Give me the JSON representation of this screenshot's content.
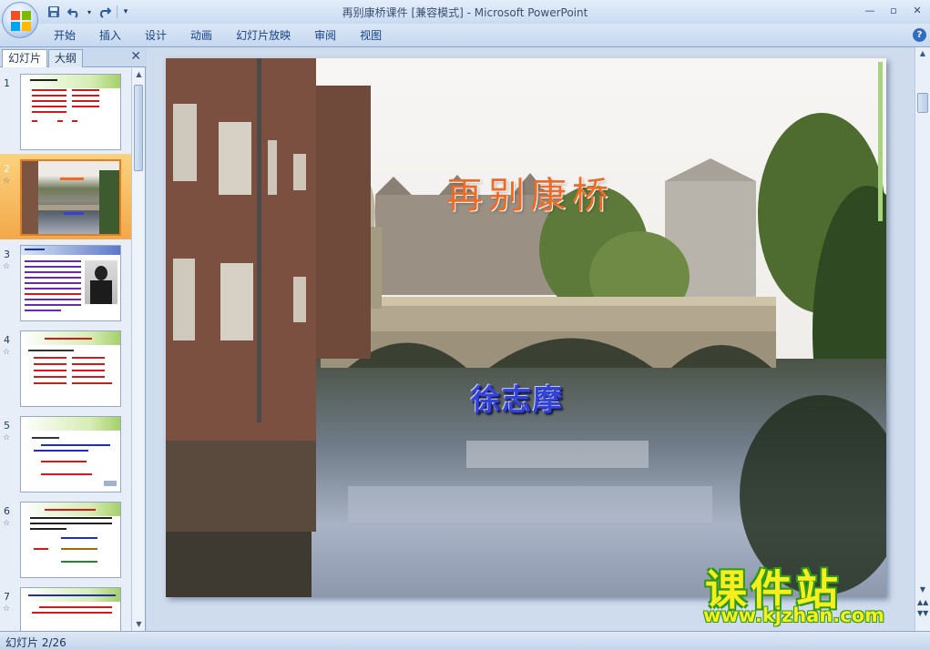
{
  "window": {
    "title": "再别康桥课件 [兼容模式] - Microsoft PowerPoint",
    "controls": {
      "minimize": "—",
      "maximize": "▫",
      "close": "✕"
    }
  },
  "qat": {
    "save_icon": "save-icon",
    "undo_icon": "undo-icon",
    "redo_icon": "redo-icon",
    "more": "▾"
  },
  "ribbon": {
    "tabs": [
      "开始",
      "插入",
      "设计",
      "动画",
      "幻灯片放映",
      "审阅",
      "视图"
    ],
    "help": "?"
  },
  "left_pane": {
    "tabs": {
      "slides": "幻灯片",
      "outline": "大纲"
    },
    "close": "✕",
    "thumbnails": [
      {
        "number": "1",
        "star": "",
        "selected": false
      },
      {
        "number": "2",
        "star": "☆",
        "selected": true
      },
      {
        "number": "3",
        "star": "☆",
        "selected": false
      },
      {
        "number": "4",
        "star": "☆",
        "selected": false
      },
      {
        "number": "5",
        "star": "☆",
        "selected": false
      },
      {
        "number": "6",
        "star": "☆",
        "selected": false
      },
      {
        "number": "7",
        "star": "☆",
        "selected": false
      }
    ]
  },
  "slide": {
    "title": "再别康桥",
    "author": "徐志摩"
  },
  "watermark": {
    "name": "课件站",
    "url": "www.kjzhan.com"
  },
  "status": {
    "slide_counter": "幻灯片 2/26"
  },
  "colors": {
    "accent_orange": "#f3a84a",
    "title_orange": "#ef6a24",
    "author_blue": "#3343d8",
    "ribbon_blue": "#c6d8ef"
  }
}
